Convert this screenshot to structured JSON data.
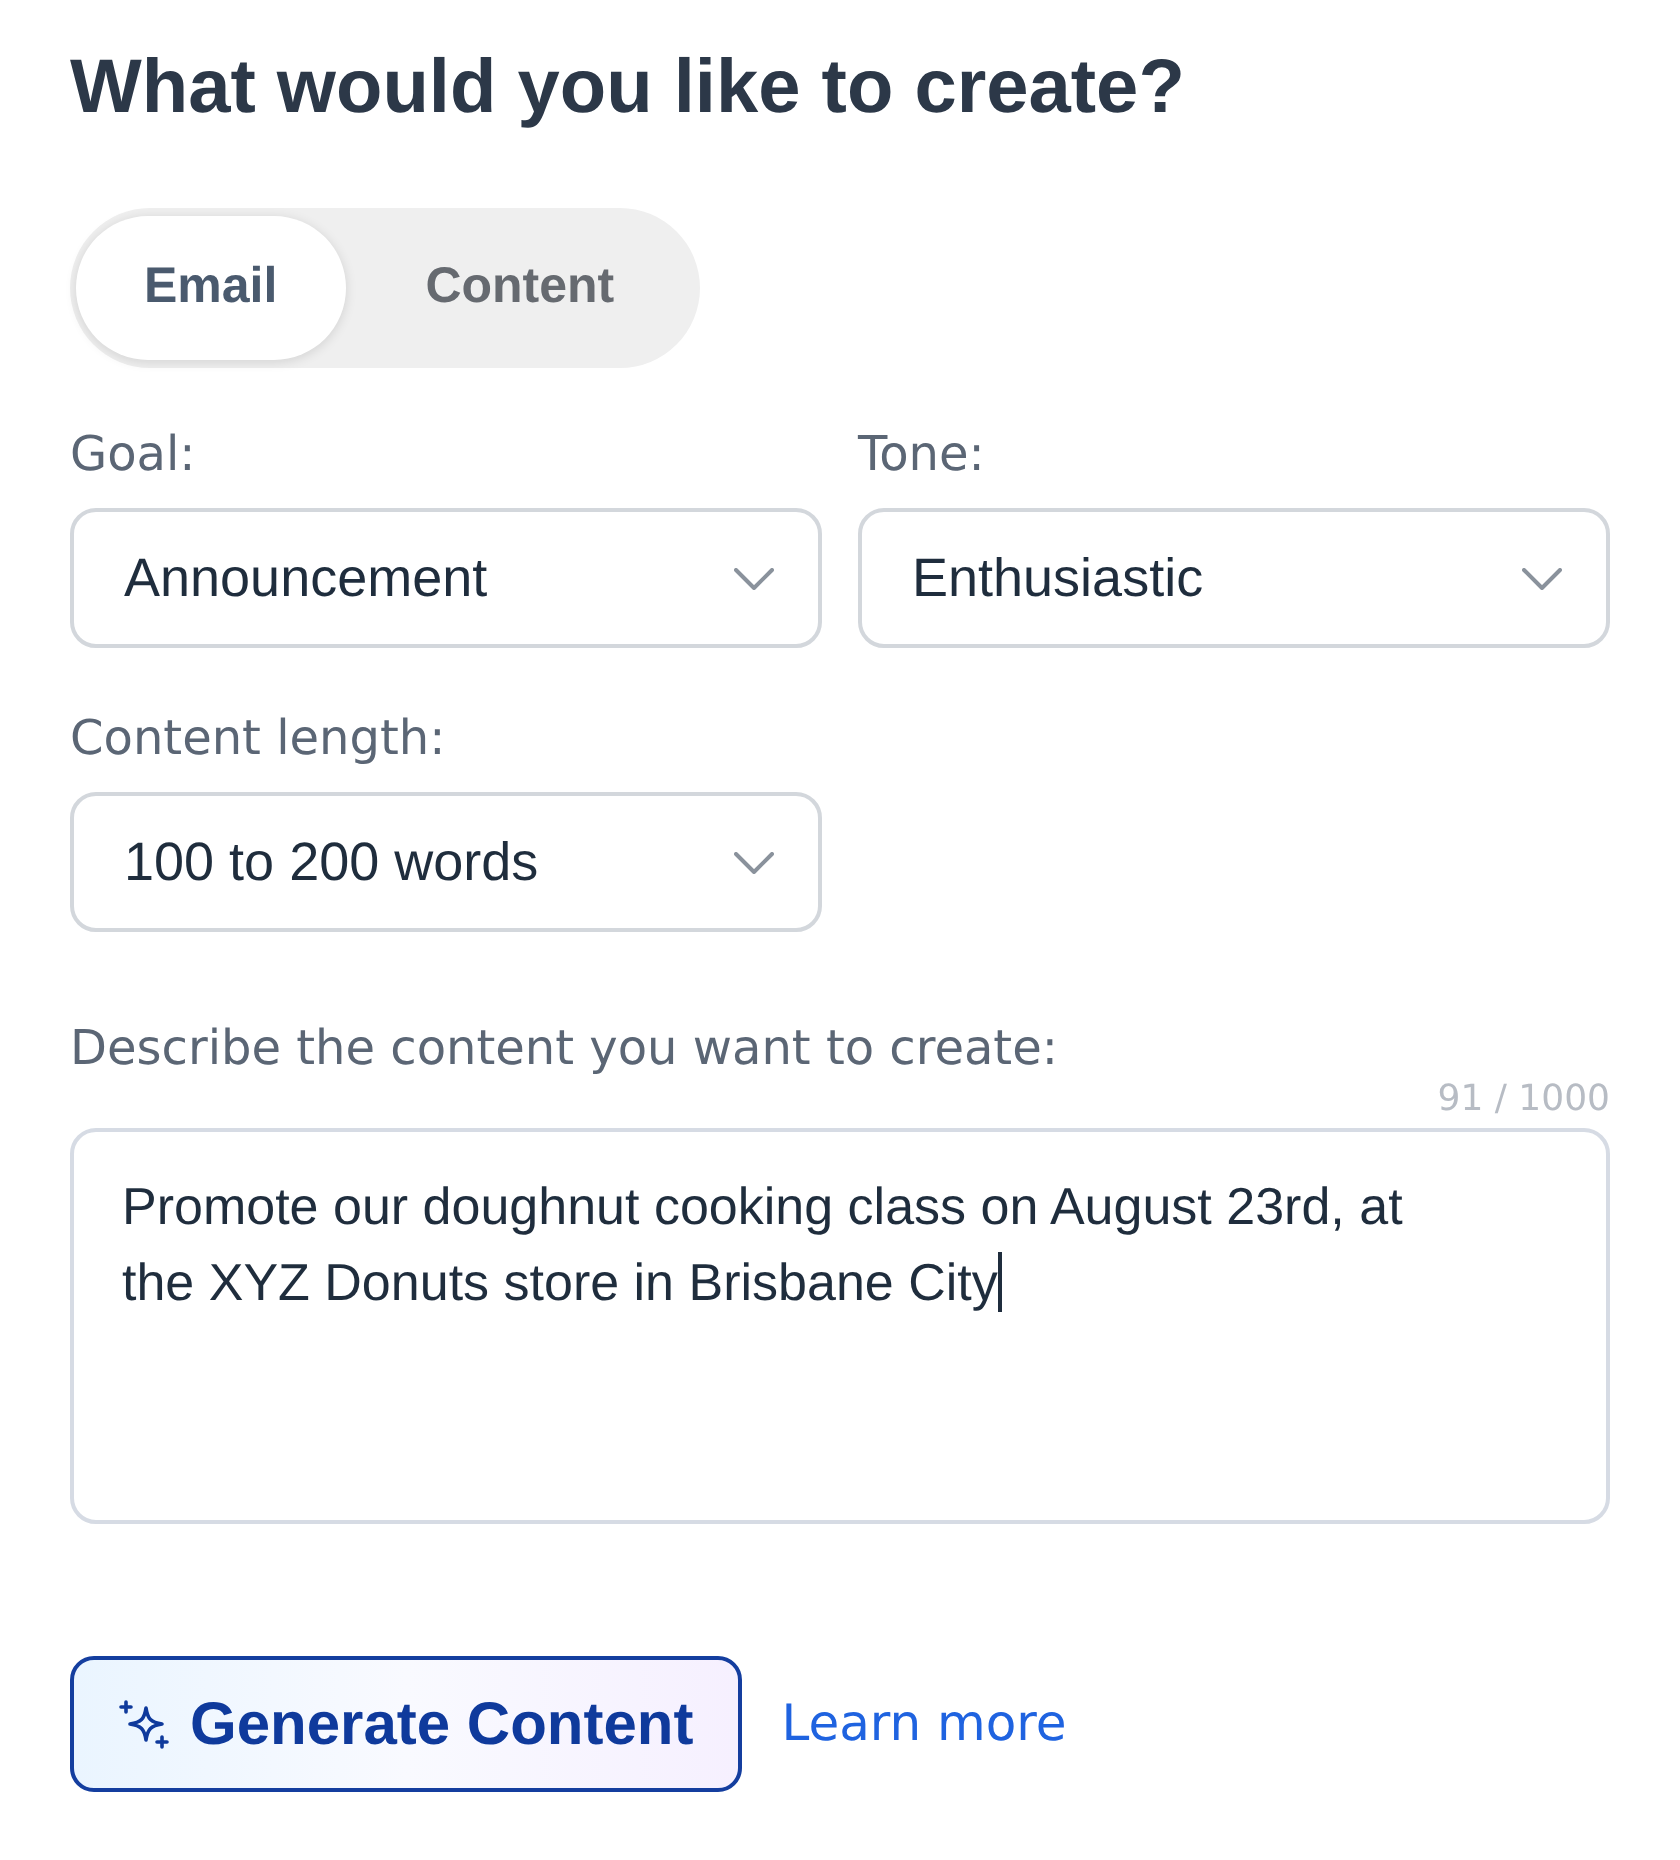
{
  "heading": "What would you like to create?",
  "mode_toggle": [
    {
      "label": "Email",
      "selected": true
    },
    {
      "label": "Content",
      "selected": false
    }
  ],
  "fields": [
    {
      "label": "Goal:",
      "value": "Announcement"
    },
    {
      "label": "Tone:",
      "value": "Enthusiastic"
    },
    {
      "label": "Content length:",
      "value": "100 to 200 words"
    }
  ],
  "description": {
    "label": "Describe the content you want to create:",
    "counter": "91 / 1000",
    "value": "Promote our doughnut cooking class on August 23rd, at the XYZ Donuts store in Brisbane City",
    "focused": true
  },
  "actions": {
    "generate_button": "Generate Content",
    "learn_more_link": "Learn more"
  }
}
